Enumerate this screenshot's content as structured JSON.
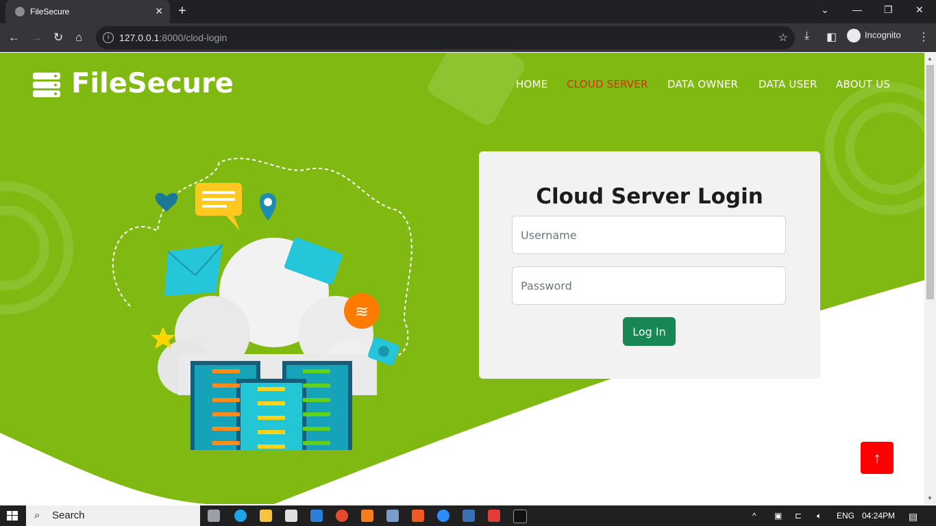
{
  "browser": {
    "tab_title": "FileSecure",
    "url_host": "127.0.0.1",
    "url_rest": ":8000/clod-login",
    "profile_label": "Incognito"
  },
  "site": {
    "brand": "FileSecure",
    "nav": [
      {
        "label": "HOME",
        "active": false
      },
      {
        "label": "CLOUD SERVER",
        "active": true
      },
      {
        "label": "DATA OWNER",
        "active": false
      },
      {
        "label": "DATA USER",
        "active": false
      },
      {
        "label": "ABOUT US",
        "active": false
      }
    ],
    "colors": {
      "brand_green": "#7fb912",
      "active_nav": "#e3261b",
      "login_button": "#198754",
      "back_to_top": "#ff0000"
    }
  },
  "login": {
    "heading": "Cloud Server Login",
    "username_placeholder": "Username",
    "password_placeholder": "Password",
    "submit_label": "Log In"
  },
  "taskbar": {
    "search_label": "Search",
    "language": "ENG",
    "time": "04:24PM"
  }
}
